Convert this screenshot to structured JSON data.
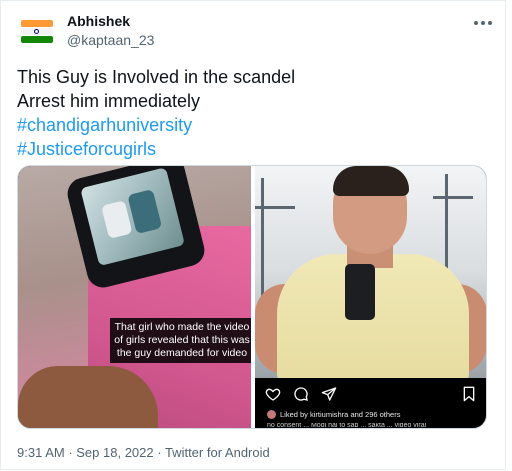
{
  "author": {
    "name": "Abhishek",
    "handle": "@kaptaan_23",
    "avatar_icon": "india-flag-icon",
    "colors": {
      "saffron": "#ff9933",
      "white": "#ffffff",
      "green": "#138808",
      "chakra": "#000080"
    }
  },
  "menu": {
    "icon": "more-options-icon"
  },
  "tweet": {
    "line1": "This Guy is Involved in the scandel",
    "line2": "Arrest him immediately",
    "hashtag1": "#chandigarhuniversity",
    "hashtag2": "#Justiceforcugirls",
    "link_color": "#1d9bf0"
  },
  "media": {
    "left_caption": "That girl who made the video of girls revealed that this was the guy demanded for video",
    "instagram": {
      "icons": [
        "heart-icon",
        "comment-icon",
        "share-icon"
      ],
      "save_icon": "bookmark-icon",
      "likes_text": "Liked by kirtiumishra and 296 others",
      "caption_cut": "no consent ... Modi hai to sab ... sakta ... video viral"
    }
  },
  "footer": {
    "time": "9:31 AM",
    "sep1": " · ",
    "date": "Sep 18, 2022",
    "sep2": " · ",
    "source": "Twitter for Android"
  }
}
